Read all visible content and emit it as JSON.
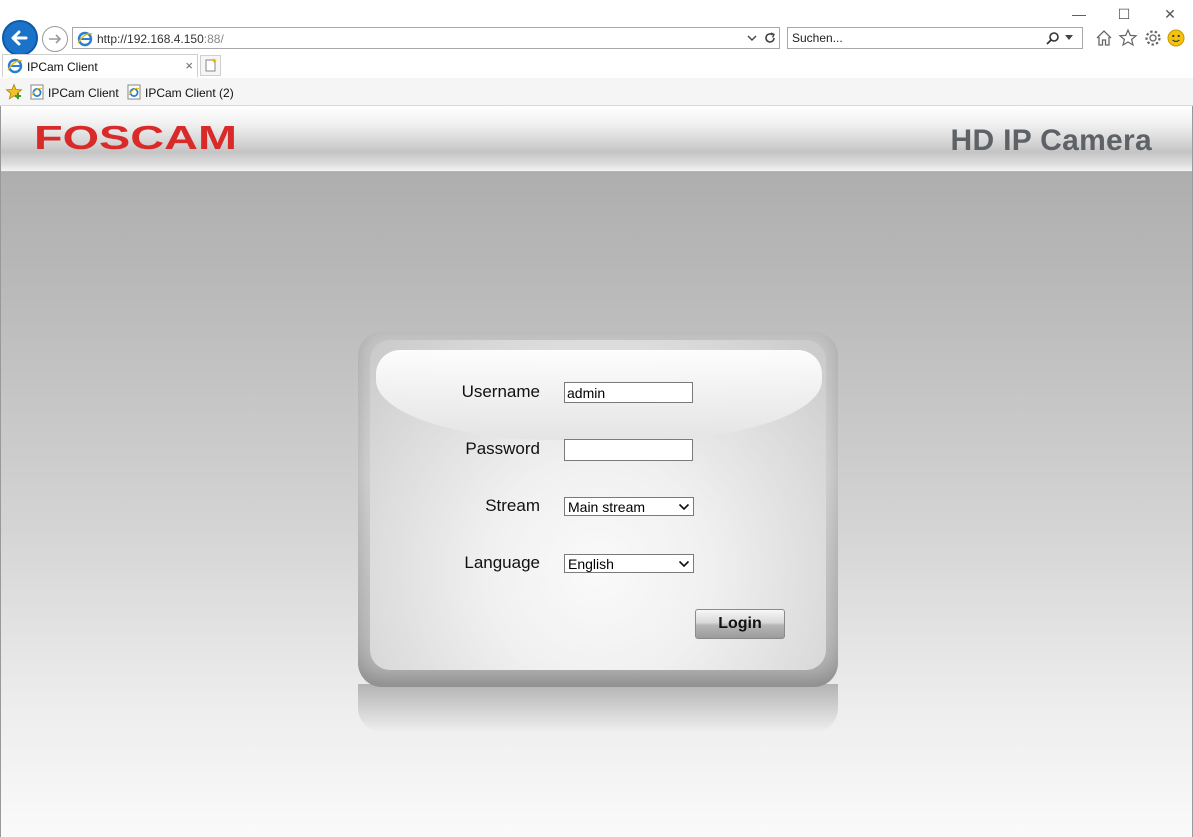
{
  "browser": {
    "window_controls": {
      "minimize": "—",
      "maximize": "☐",
      "close": "✕"
    },
    "address": {
      "url_main": "http://192.168.4.150",
      "url_port": ":88/"
    },
    "search": {
      "placeholder": "Suchen..."
    },
    "tabs": [
      {
        "label": "IPCam Client",
        "close": "×"
      }
    ],
    "favorites": [
      {
        "label": "IPCam Client"
      },
      {
        "label": "IPCam Client (2)"
      }
    ],
    "icons": [
      "back-arrow-icon",
      "forward-arrow-icon",
      "ie-logo-icon",
      "dropdown-icon",
      "refresh-icon",
      "search-icon",
      "home-icon",
      "star-icon",
      "gear-icon",
      "smiley-icon",
      "new-tab-icon",
      "favorites-star-icon"
    ]
  },
  "header": {
    "logo_text": "FOSCAM",
    "product_title": "HD IP Camera"
  },
  "login": {
    "username_label": "Username",
    "username_value": "admin",
    "password_label": "Password",
    "password_value": "",
    "stream_label": "Stream",
    "stream_value": "Main stream",
    "language_label": "Language",
    "language_value": "English",
    "login_button": "Login"
  },
  "colors": {
    "brand_red": "#d92a2a",
    "browser_blue": "#1a73c9",
    "title_gray": "#5e6165"
  }
}
